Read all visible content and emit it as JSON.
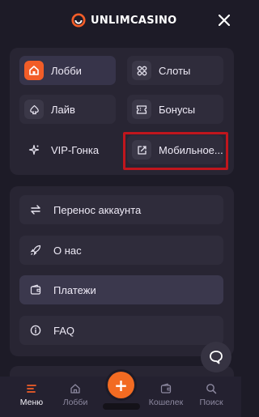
{
  "header": {
    "logo_text": "unlimcasino",
    "close_icon": "close-icon"
  },
  "menu_grid": [
    {
      "label": "Лобби",
      "icon": "home-icon",
      "active": true
    },
    {
      "label": "Слоты",
      "icon": "grid-icon",
      "active": false
    },
    {
      "label": "Лайв",
      "icon": "spade-icon",
      "active": false
    },
    {
      "label": "Бонусы",
      "icon": "ticket-icon",
      "active": false
    },
    {
      "label": "VIP-Гонка",
      "icon": "sparkle-icon",
      "active": false
    },
    {
      "label": "Мобильное...",
      "icon": "external-edit-icon",
      "active": false
    }
  ],
  "menu_list": [
    {
      "label": "Перенос аккаунта",
      "icon": "transfer-icon",
      "active": false
    },
    {
      "label": "О нас",
      "icon": "rocket-icon",
      "active": false
    },
    {
      "label": "Платежи",
      "icon": "wallet-icon",
      "active": true
    },
    {
      "label": "FAQ",
      "icon": "info-icon",
      "active": false
    }
  ],
  "bottom_nav": [
    {
      "label": "Меню",
      "icon": "menu-icon",
      "active": true
    },
    {
      "label": "Лобби",
      "icon": "home-icon",
      "active": false
    },
    {
      "label": "Кошелек",
      "icon": "wallet-icon",
      "active": false
    },
    {
      "label": "Поиск",
      "icon": "search-icon",
      "active": false
    }
  ],
  "fab": {
    "symbol": "+",
    "icon": "plus-icon"
  },
  "chat": {
    "icon": "chat-icon"
  },
  "colors": {
    "background": "#1d1b27",
    "panel": "#282533",
    "tile": "#2f2c3b",
    "accent": "#f25d28",
    "highlight": "#c0161d"
  }
}
